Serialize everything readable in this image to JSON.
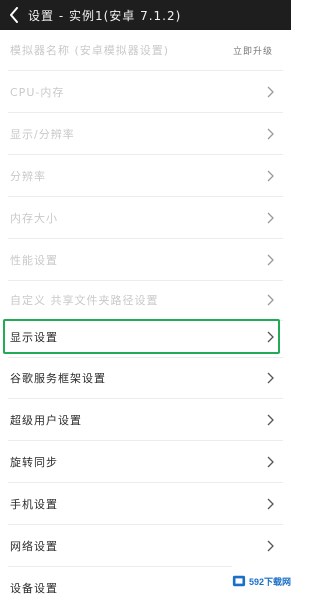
{
  "header": {
    "title": "设置 - 实例1(安卓 7.1.2)"
  },
  "rows": [
    {
      "label": "模拟器名称 (安卓模拟器设置)",
      "right_text": "立即升级",
      "dim": true
    },
    {
      "label": "CPU-内存",
      "dim": true
    },
    {
      "label": "显示/分辨率",
      "dim": true
    },
    {
      "label": "   分辨率",
      "dim": true
    },
    {
      "label": "   内存大小",
      "dim": true
    },
    {
      "label": "性能设置",
      "dim": true
    },
    {
      "label": "自定义 共享文件夹路径设置",
      "dim": true
    },
    {
      "label": "显示设置",
      "dim": false
    },
    {
      "label": "谷歌服务框架设置",
      "dim": false
    },
    {
      "label": "超级用户设置",
      "dim": false
    },
    {
      "label": "旋转同步",
      "dim": false
    },
    {
      "label": "手机设置",
      "dim": false
    },
    {
      "label": "网络设置",
      "dim": false
    },
    {
      "label": "设备设置",
      "dim": false
    }
  ],
  "watermark": {
    "text": "592下载网"
  },
  "colors": {
    "header_bg": "#1e1e1e",
    "highlight": "#22aa55",
    "watermark": "#1b6fc8"
  }
}
